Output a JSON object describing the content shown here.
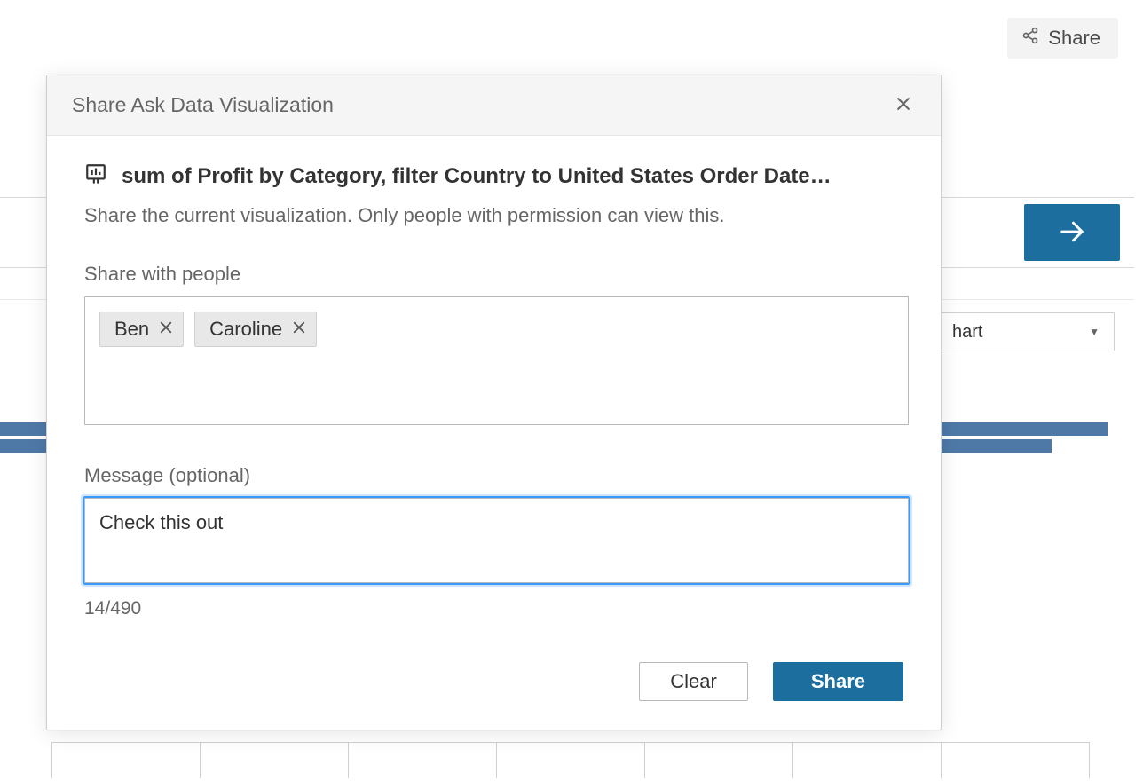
{
  "topbar": {
    "share_label": "Share"
  },
  "background": {
    "chart_type_value": "hart"
  },
  "modal": {
    "title": "Share Ask Data Visualization",
    "query": "sum of Profit by Category, filter Country to United States Order Date…",
    "helper": "Share the current visualization. Only people with permission can view this.",
    "people_label": "Share with people",
    "people": [
      {
        "name": "Ben"
      },
      {
        "name": "Caroline"
      }
    ],
    "message_label": "Message (optional)",
    "message_value": "Check this out",
    "char_count": "14/490",
    "clear_label": "Clear",
    "share_label": "Share"
  }
}
